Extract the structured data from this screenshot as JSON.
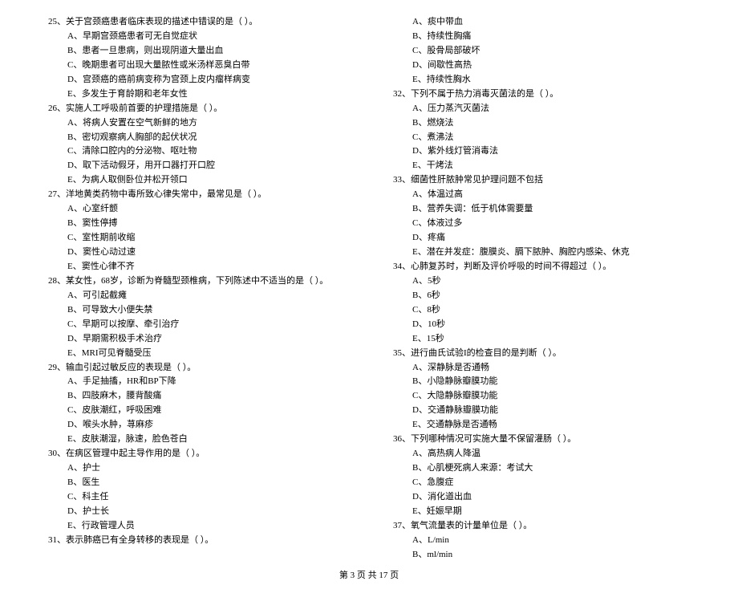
{
  "footer": "第 3 页 共 17 页",
  "left": [
    {
      "n": "25、",
      "stem": "关于宫颈癌患者临床表现的描述中错误的是（    ）。",
      "opts": [
        "A、早期宫颈癌患者可无自觉症状",
        "B、患者一旦患病，则出现阴道大量出血",
        "C、晚期患者可出现大量脓性或米汤样恶臭白带",
        "D、宫颈癌的癌前病变称为宫颈上皮内瘤样病变",
        "E、多发生于育龄期和老年女性"
      ]
    },
    {
      "n": "26、",
      "stem": "实施人工呼吸前首要的护理措施是（    ）。",
      "opts": [
        "A、将病人安置在空气新鲜的地方",
        "B、密切观察病人胸部的起伏状况",
        "C、清除口腔内的分泌物、呕吐物",
        "D、取下活动假牙，用开口器打开口腔",
        "E、为病人取侧卧位并松开领口"
      ]
    },
    {
      "n": "27、",
      "stem": "洋地黄类药物中毒所致心律失常中，最常见是（    ）。",
      "opts": [
        "A、心室纤颤",
        "B、窦性停搏",
        "C、室性期前收缩",
        "D、窦性心动过速",
        "E、窦性心律不齐"
      ]
    },
    {
      "n": "28、",
      "stem": "某女性，68岁，诊断为脊髓型颈椎病，下列陈述中不适当的是（    ）。",
      "opts": [
        "A、可引起截瘫",
        "B、可导致大小便失禁",
        "C、早期可以按摩、牵引治疗",
        "D、早期需积极手术治疗",
        "E、MRI可见脊髓受压"
      ]
    },
    {
      "n": "29、",
      "stem": "输血引起过敏反应的表现是（    ）。",
      "opts": [
        "A、手足抽搐，HR和BP下降",
        "B、四肢麻木，腰背酸痛",
        "C、皮肤潮红，呼吸困难",
        "D、喉头水肿，荨麻疹",
        "E、皮肤潮湿，脉速，脸色苍白"
      ]
    },
    {
      "n": "30、",
      "stem": "在病区管理中起主导作用的是（    ）。",
      "opts": [
        "A、护士",
        "B、医生",
        "C、科主任",
        "D、护士长",
        "E、行政管理人员"
      ]
    },
    {
      "n": "31、",
      "stem": "表示肺癌已有全身转移的表现是（    ）。",
      "opts": []
    }
  ],
  "right": [
    {
      "n": "",
      "stem": "",
      "opts": [
        "A、痰中带血",
        "B、持续性胸痛",
        "C、股骨局部破坏",
        "D、间歇性高热",
        "E、持续性胸水"
      ]
    },
    {
      "n": "32、",
      "stem": "下列不属于热力消毒灭菌法的是（    ）。",
      "opts": [
        "A、压力蒸汽灭菌法",
        "B、燃烧法",
        "C、煮沸法",
        "D、紫外线灯管消毒法",
        "E、干烤法"
      ]
    },
    {
      "n": "33、",
      "stem": "细菌性肝脓肿常见护理问题不包括",
      "opts": [
        "A、体温过高",
        "B、营养失调：低于机体需要量",
        "C、体液过多",
        "D、疼痛",
        "E、潜在并发症：腹膜炎、膈下脓肿、胸腔内感染、休克"
      ]
    },
    {
      "n": "34、",
      "stem": "心肺复苏时，判断及评价呼吸的时间不得超过（    ）。",
      "opts": [
        "A、5秒",
        "B、6秒",
        "C、8秒",
        "D、10秒",
        "E、15秒"
      ]
    },
    {
      "n": "35、",
      "stem": "进行曲氏试验I的检查目的是判断（    ）。",
      "opts": [
        "A、深静脉是否通畅",
        "B、小隐静脉瓣膜功能",
        "C、大隐静脉瓣膜功能",
        "D、交通静脉瓣膜功能",
        "E、交通静脉是否通畅"
      ]
    },
    {
      "n": "36、",
      "stem": "下列哪种情况可实施大量不保留灌肠（    ）。",
      "opts": [
        "A、高热病人降温",
        "B、心肌梗死病人来源：考试大",
        "C、急腹症",
        "D、消化道出血",
        "E、妊娠早期"
      ]
    },
    {
      "n": "37、",
      "stem": "氧气流量表的计量单位是（    ）。",
      "opts": [
        "A、L/min",
        "B、ml/min"
      ]
    }
  ]
}
